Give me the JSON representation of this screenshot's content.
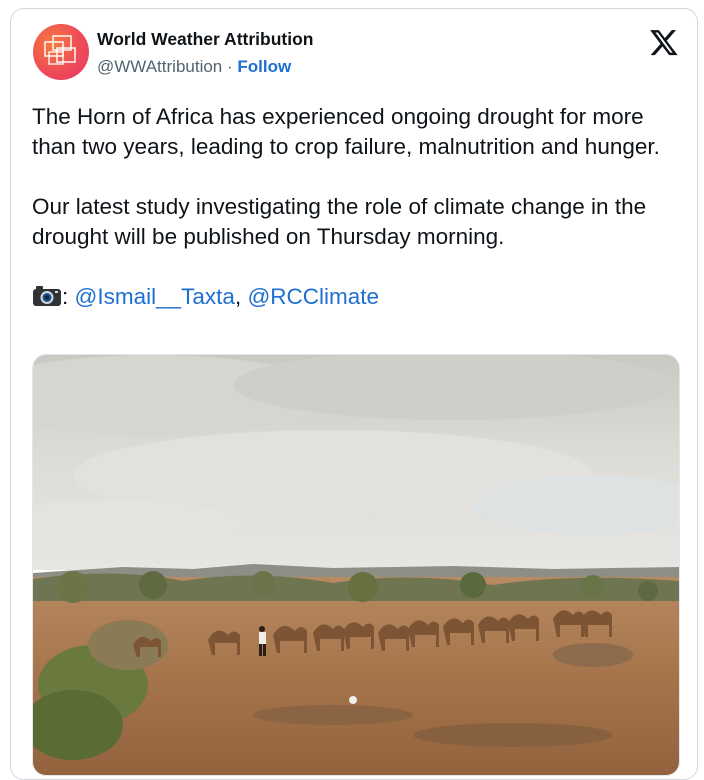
{
  "author": {
    "name": "World Weather Attribution",
    "handle": "@WWAttribution",
    "separator": "·",
    "follow_label": "Follow"
  },
  "icons": {
    "avatar": "wwa-logo",
    "platform": "x-logo",
    "camera": "camera-emoji"
  },
  "tweet": {
    "paragraph1": "The Horn of Africa has experienced ongoing drought for more than two years, leading to crop failure, malnutrition and hunger.",
    "paragraph2": "Our latest study investigating the role of climate change in the drought will be published on Thursday morning.",
    "credit_colon": ":",
    "mention1": "@Ismail__Taxta",
    "comma": ",",
    "mention2": "@RCClimate"
  },
  "colors": {
    "link": "#1d6fd0",
    "text": "#0f1419",
    "muted": "#536471",
    "border": "#cfd9de"
  }
}
